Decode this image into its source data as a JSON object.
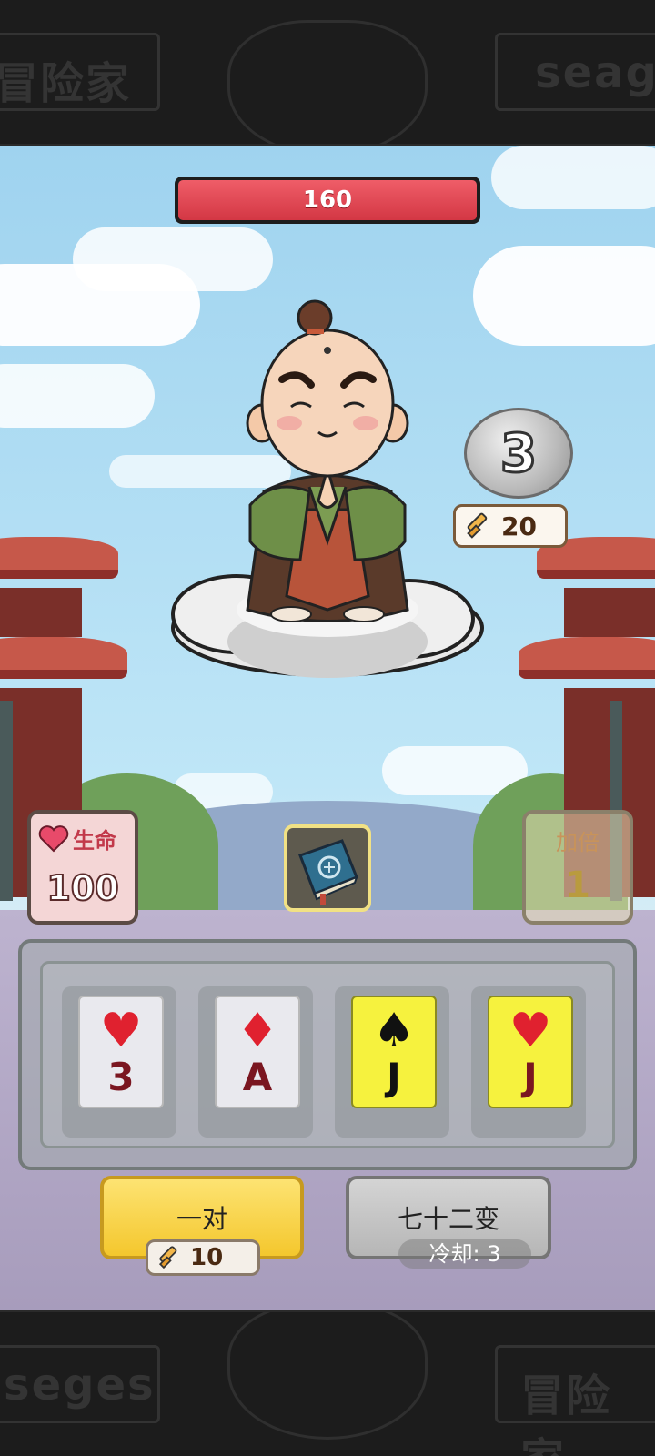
{
  "banner": {
    "top_left_word": "冒险家",
    "top_right_word": "seaga",
    "bottom_left_word": "seges",
    "bottom_right_word": "冒险家"
  },
  "enemy": {
    "hp": "160",
    "hp_fraction": 1.0
  },
  "coin": {
    "value": "3"
  },
  "attack_badge": {
    "value": "20",
    "icon": "sword-icon"
  },
  "life": {
    "label": "生命",
    "value": "100",
    "icon": "heart-icon"
  },
  "multiplier": {
    "label": "加倍",
    "value": "1"
  },
  "item": {
    "icon": "book-icon"
  },
  "cards": [
    {
      "suit": "♥",
      "rank": "3",
      "style": "white",
      "suit_color": "red"
    },
    {
      "suit": "♦",
      "rank": "A",
      "style": "white",
      "suit_color": "red"
    },
    {
      "suit": "♠",
      "rank": "J",
      "style": "yellow",
      "suit_color": "black"
    },
    {
      "suit": "♥",
      "rank": "J",
      "style": "yellow",
      "suit_color": "red"
    }
  ],
  "actions": {
    "play_label": "一对",
    "play_cost": "10",
    "skill_label": "七十二变",
    "skill_cooldown": "冷却: 3"
  },
  "colors": {
    "hp_red": "#d33744",
    "play_yellow": "#f4c72d",
    "card_yellow": "#f6f23e",
    "life_red": "#c2394a"
  }
}
